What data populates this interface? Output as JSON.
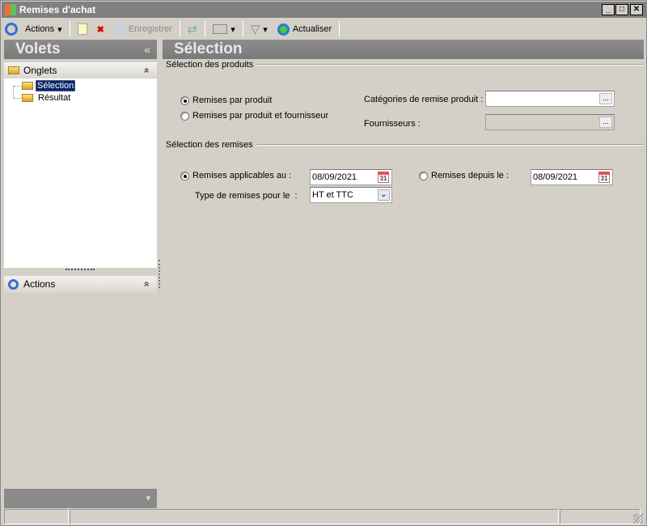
{
  "window": {
    "title": "Remises d'achat",
    "min": "_",
    "max": "□",
    "close": "✕"
  },
  "toolbar": {
    "actions": "Actions",
    "save": "Enregistrer",
    "refresh": "Actualiser"
  },
  "left": {
    "title": "Volets",
    "collapse": "«",
    "onglets": "Onglets",
    "tree": [
      "Sélection",
      "Résultat"
    ],
    "actions": "Actions",
    "expand": "»"
  },
  "main": {
    "title": "Sélection",
    "produits": {
      "group": "Sélection des produits",
      "radio1": "Remises par produit",
      "radio2": "Remises par produit et fournisseur",
      "cat_label": "Catégories de remise produit :",
      "cat_value": "",
      "four_label": "Fournisseurs :",
      "four_value": ""
    },
    "remises": {
      "group": "Sélection des remises",
      "radio1": "Remises applicables au :",
      "date1": "08/09/2021",
      "radio2": "Remises depuis le :",
      "date2": "08/09/2021",
      "type_label": "Type de remises pour le  :",
      "type_value": "HT et TTC"
    },
    "cal_day": "31",
    "ellipsis": "..."
  }
}
